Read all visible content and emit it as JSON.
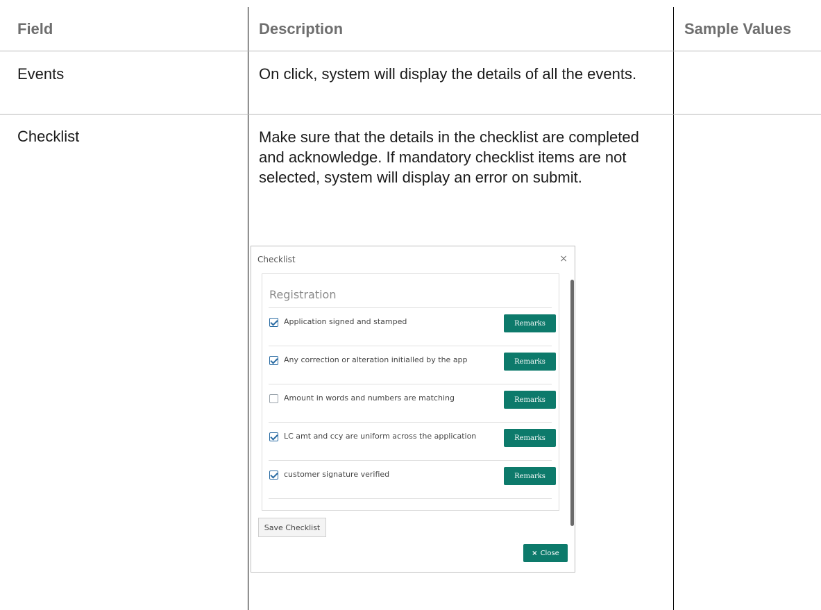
{
  "table": {
    "headers": {
      "field": "Field",
      "description": "Description",
      "sample": "Sample Values"
    },
    "rows": [
      {
        "field": "Events",
        "description": "On click, system will display the details of all the events.",
        "sample": ""
      },
      {
        "field": "Checklist",
        "description": "Make sure that the details in the checklist are completed and acknowledge. If mandatory checklist items are not selected, system will display an error on submit.",
        "sample": ""
      }
    ]
  },
  "dialog": {
    "title": "Checklist",
    "close_x": "×",
    "section": "Registration",
    "items": [
      {
        "label": "Application signed and stamped",
        "checked": true,
        "button": "Remarks"
      },
      {
        "label": "Any correction or alteration initialled by the  app",
        "checked": true,
        "button": "Remarks"
      },
      {
        "label": "Amount in words and numbers are matching",
        "checked": false,
        "button": "Remarks"
      },
      {
        "label": "LC amt and ccy are uniform across the application",
        "checked": true,
        "button": "Remarks"
      },
      {
        "label": "customer signature verified",
        "checked": true,
        "button": "Remarks"
      }
    ],
    "save_label": "Save Checklist",
    "close_label": "Close",
    "close_icon": "×",
    "colors": {
      "accent": "#0d7a6b",
      "checkbox": "#2b6ca3"
    }
  }
}
